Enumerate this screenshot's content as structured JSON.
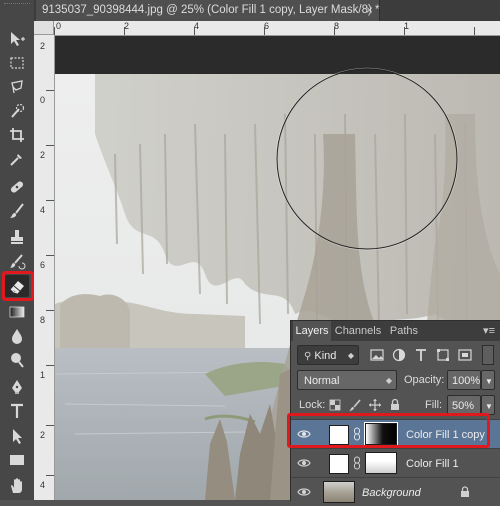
{
  "document": {
    "tab_title": "9135037_90398444.jpg @ 25% (Color Fill 1 copy, Layer Mask/8) *",
    "close_glyph": "×"
  },
  "rulers": {
    "top_numbers": [
      "2",
      "0",
      "2",
      "4",
      "6",
      "8",
      "1"
    ],
    "left_numbers": [
      "2",
      "0",
      "2",
      "4",
      "6",
      "8",
      "1",
      "2",
      "4"
    ]
  },
  "tools": [
    {
      "name": "move-tool",
      "icon": "move-icon"
    },
    {
      "name": "marquee-tool",
      "icon": "rect-marquee-icon"
    },
    {
      "name": "lasso-tool",
      "icon": "lasso-icon"
    },
    {
      "name": "quick-selection-tool",
      "icon": "quick-select-icon"
    },
    {
      "name": "crop-tool",
      "icon": "crop-icon"
    },
    {
      "name": "eyedropper-tool",
      "icon": "eyedropper-icon"
    },
    {
      "name": "healing-brush-tool",
      "icon": "bandage-icon"
    },
    {
      "name": "brush-tool",
      "icon": "brush-icon"
    },
    {
      "name": "clone-stamp-tool",
      "icon": "stamp-icon"
    },
    {
      "name": "history-brush-tool",
      "icon": "history-brush-icon"
    },
    {
      "name": "eraser-tool",
      "icon": "eraser-icon",
      "selected": true
    },
    {
      "name": "gradient-tool",
      "icon": "gradient-icon"
    },
    {
      "name": "blur-tool",
      "icon": "drop-icon"
    },
    {
      "name": "dodge-tool",
      "icon": "dodge-icon"
    },
    {
      "name": "pen-tool",
      "icon": "pen-icon"
    },
    {
      "name": "type-tool",
      "icon": "type-icon"
    },
    {
      "name": "path-selection-tool",
      "icon": "arrow-icon"
    },
    {
      "name": "shape-tool",
      "icon": "rectangle-icon"
    },
    {
      "name": "hand-tool",
      "icon": "hand-icon"
    }
  ],
  "highlight_color": "#e0191e",
  "layers_panel": {
    "tabs": [
      "Layers",
      "Channels",
      "Paths"
    ],
    "active_tab": "Layers",
    "menu_glyph": "▾≡",
    "filter_kind": "Kind",
    "blend_mode": "Normal",
    "opacity_label": "Opacity:",
    "opacity_value": "100%",
    "lock_label": "Lock:",
    "fill_label": "Fill:",
    "fill_value": "50%",
    "layers": [
      {
        "name": "Color Fill 1 copy",
        "selected": true,
        "type": "fill-with-mask"
      },
      {
        "name": "Color Fill 1",
        "selected": false,
        "type": "fill-with-mask"
      },
      {
        "name": "Background",
        "selected": false,
        "type": "background",
        "italic": true,
        "locked": true
      }
    ]
  }
}
